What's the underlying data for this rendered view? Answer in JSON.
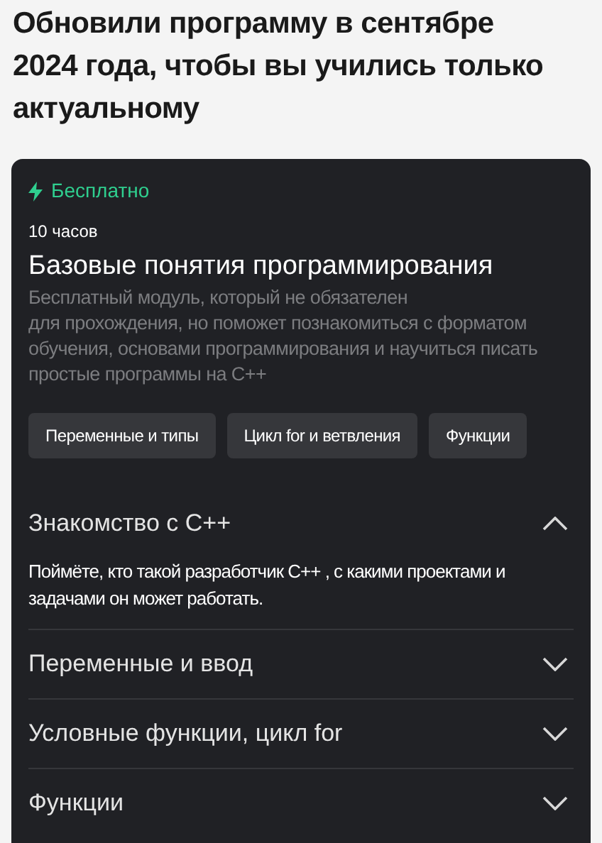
{
  "heading": "Обновили программу в сентябре 2024 года, чтобы вы учились только актуальному",
  "card": {
    "badge": "Бесплатно",
    "duration": "10 часов",
    "title": "Базовые понятия программирования",
    "description": "Бесплатный модуль, который не обязателен\nдля прохождения, но поможет познакомиться с форматом обучения, основами программирования и научиться писать простые программы на C++",
    "tags": [
      "Переменные и типы",
      "Цикл for и ветвления",
      "Функции"
    ],
    "sections": [
      {
        "title": "Знакомство с C++",
        "expanded": true,
        "description": "Поймёте, кто такой разработчик C++ , с какими проектами и задачами он может работать."
      },
      {
        "title": "Переменные и ввод",
        "expanded": false
      },
      {
        "title": "Условные функции, цикл for",
        "expanded": false
      },
      {
        "title": "Функции",
        "expanded": false
      }
    ]
  }
}
